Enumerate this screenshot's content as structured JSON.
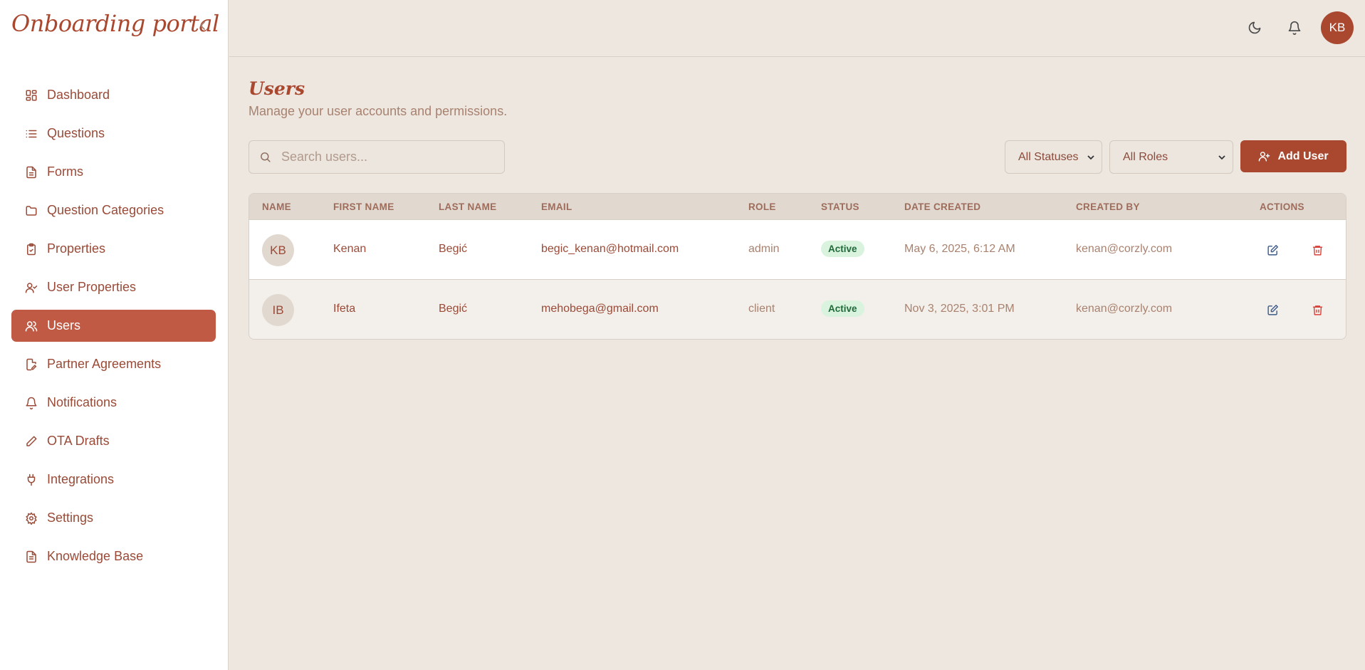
{
  "app": {
    "title": "Onboarding portal"
  },
  "sidebar": {
    "items": [
      {
        "label": "Dashboard",
        "icon": "dashboard-icon",
        "active": false
      },
      {
        "label": "Questions",
        "icon": "list-icon",
        "active": false
      },
      {
        "label": "Forms",
        "icon": "document-icon",
        "active": false
      },
      {
        "label": "Question Categories",
        "icon": "folder-icon",
        "active": false
      },
      {
        "label": "Properties",
        "icon": "clipboard-icon",
        "active": false
      },
      {
        "label": "User Properties",
        "icon": "user-check-icon",
        "active": false
      },
      {
        "label": "Users",
        "icon": "users-icon",
        "active": true
      },
      {
        "label": "Partner Agreements",
        "icon": "file-edit-icon",
        "active": false
      },
      {
        "label": "Notifications",
        "icon": "bell-icon",
        "active": false
      },
      {
        "label": "OTA Drafts",
        "icon": "pencil-icon",
        "active": false
      },
      {
        "label": "Integrations",
        "icon": "plug-icon",
        "active": false
      },
      {
        "label": "Settings",
        "icon": "gear-icon",
        "active": false
      },
      {
        "label": "Knowledge Base",
        "icon": "file-text-icon",
        "active": false
      }
    ]
  },
  "header": {
    "avatar_initials": "KB"
  },
  "main": {
    "title": "Users",
    "subtitle": "Manage your user accounts and permissions.",
    "search_placeholder": "Search users...",
    "status_filter": "All Statuses",
    "role_filter": "All Roles",
    "add_button": "Add User"
  },
  "table": {
    "columns": [
      "NAME",
      "FIRST NAME",
      "LAST NAME",
      "EMAIL",
      "ROLE",
      "STATUS",
      "DATE CREATED",
      "CREATED BY",
      "ACTIONS"
    ],
    "rows": [
      {
        "initials": "KB",
        "first_name": "Kenan",
        "last_name": "Begić",
        "email": "begic_kenan@hotmail.com",
        "role": "admin",
        "status": "Active",
        "date_created": "May 6, 2025, 6:12 AM",
        "created_by": "kenan@corzly.com"
      },
      {
        "initials": "IB",
        "first_name": "Ifeta",
        "last_name": "Begić",
        "email": "mehobega@gmail.com",
        "role": "client",
        "status": "Active",
        "date_created": "Nov 3, 2025, 3:01 PM",
        "created_by": "kenan@corzly.com"
      }
    ]
  },
  "colors": {
    "accent": "#a9472f",
    "active_nav": "#c05a44",
    "background": "#ede7e0",
    "badge_bg": "#d9f3de",
    "badge_text": "#21693a",
    "edit_icon": "#3b5b8a",
    "delete_icon": "#d9423a"
  }
}
